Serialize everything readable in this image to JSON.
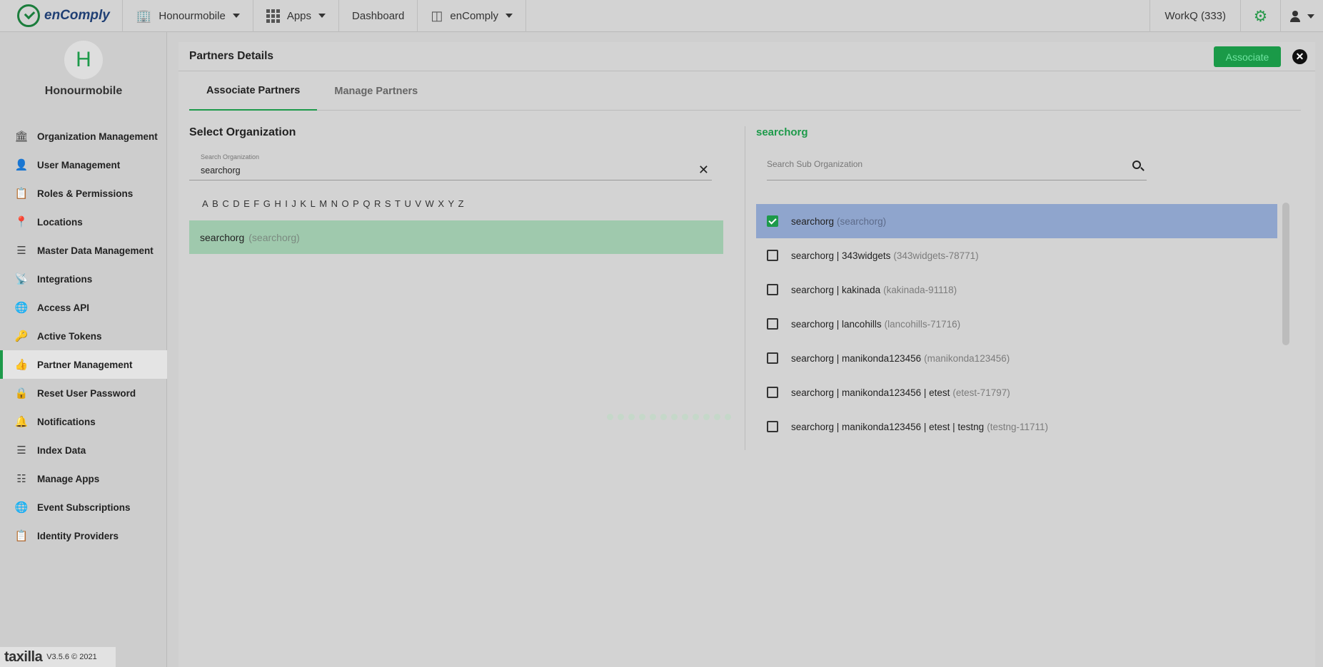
{
  "topbar": {
    "logo_text": "enComply",
    "org_menu": "Honourmobile",
    "apps_menu": "Apps",
    "dashboard": "Dashboard",
    "app_menu": "enComply",
    "workq": "WorkQ (333)"
  },
  "sidebar": {
    "avatar_letter": "H",
    "org_name": "Honourmobile",
    "items": [
      {
        "label": "Organization Management",
        "icon": "bank-icon"
      },
      {
        "label": "User Management",
        "icon": "person-icon"
      },
      {
        "label": "Roles & Permissions",
        "icon": "clipboard-icon"
      },
      {
        "label": "Locations",
        "icon": "location-pin-icon"
      },
      {
        "label": "Master Data Management",
        "icon": "list-icon"
      },
      {
        "label": "Integrations",
        "icon": "antenna-icon"
      },
      {
        "label": "Access API",
        "icon": "globe-icon"
      },
      {
        "label": "Active Tokens",
        "icon": "key-icon"
      },
      {
        "label": "Partner Management",
        "icon": "thumbs-up-icon",
        "active": true
      },
      {
        "label": "Reset User Password",
        "icon": "lock-icon"
      },
      {
        "label": "Notifications",
        "icon": "bell-icon"
      },
      {
        "label": "Index Data",
        "icon": "table-list-icon"
      },
      {
        "label": "Manage Apps",
        "icon": "apps-grid-icon"
      },
      {
        "label": "Event Subscriptions",
        "icon": "globe-icon"
      },
      {
        "label": "Identity Providers",
        "icon": "id-badge-icon"
      }
    ],
    "footer_brand": "taxilla",
    "footer_version": "V3.5.6 © 2021"
  },
  "panel": {
    "title": "Partners Details",
    "associate_label": "Associate",
    "tabs": [
      "Associate Partners",
      "Manage Partners"
    ],
    "left": {
      "title": "Select Organization",
      "search_label": "Search Organization",
      "search_value": "searchorg",
      "alphabet": [
        "A",
        "B",
        "C",
        "D",
        "E",
        "F",
        "G",
        "H",
        "I",
        "J",
        "K",
        "L",
        "M",
        "N",
        "O",
        "P",
        "Q",
        "R",
        "S",
        "T",
        "U",
        "V",
        "W",
        "X",
        "Y",
        "Z"
      ],
      "result_name": "searchorg",
      "result_code": "(searchorg)"
    },
    "right": {
      "title": "searchorg",
      "search_placeholder": "Search Sub Organization",
      "rows": [
        {
          "name": "searchorg",
          "code": "(searchorg)",
          "checked": true
        },
        {
          "name": "searchorg | 343widgets",
          "code": "(343widgets-78771)",
          "checked": false
        },
        {
          "name": "searchorg | kakinada",
          "code": "(kakinada-91118)",
          "checked": false
        },
        {
          "name": "searchorg | lancohills",
          "code": "(lancohills-71716)",
          "checked": false
        },
        {
          "name": "searchorg | manikonda123456",
          "code": "(manikonda123456)",
          "checked": false
        },
        {
          "name": "searchorg | manikonda123456 | etest",
          "code": "(etest-71797)",
          "checked": false
        },
        {
          "name": "searchorg | manikonda123456 | etest | testng",
          "code": "(testng-11711)",
          "checked": false
        }
      ]
    }
  },
  "colors": {
    "accent": "#1d9a4a",
    "selected_row": "#8fa5cd",
    "org_row": "#9fc9ad"
  }
}
